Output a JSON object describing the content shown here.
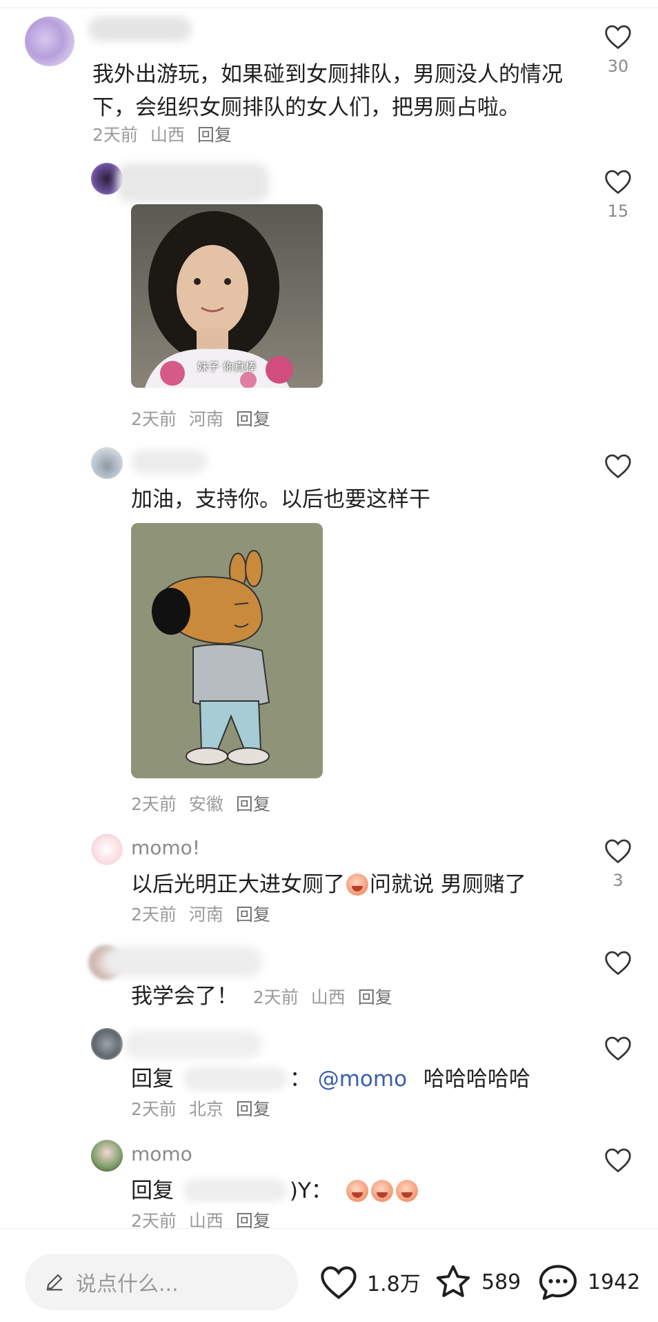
{
  "comments": [
    {
      "text": "我外出游玩，如果碰到女厕排队，男厕没人的情况下，会组织女厕排队的女人们，把男厕占啦。",
      "time": "2天前",
      "location": "山西",
      "reply": "回复",
      "likes": "30"
    },
    {
      "image_caption": "妹子 你真棒",
      "time": "2天前",
      "location": "河南",
      "reply": "回复",
      "likes": "15"
    },
    {
      "text": "加油，支持你。以后也要这样干",
      "time": "2天前",
      "location": "安徽",
      "reply": "回复",
      "likes": ""
    },
    {
      "name": "momo!",
      "text_before_emoji": "以后光明正大进女厕了",
      "text_after_emoji": "问就说 男厕赌了",
      "time": "2天前",
      "location": "河南",
      "reply": "回复",
      "likes": "3"
    },
    {
      "text": "我学会了！",
      "time": "2天前",
      "location": "山西",
      "reply": "回复",
      "likes": ""
    },
    {
      "reply_prefix": "回复",
      "reply_sep": "：",
      "mention": "@momo",
      "text": "哈哈哈哈哈",
      "time": "2天前",
      "location": "北京",
      "reply": "回复",
      "likes": ""
    },
    {
      "name": "momo",
      "reply_prefix": "回复",
      "reply_sep": ")Y：",
      "time": "2天前",
      "location": "山西",
      "reply": "回复",
      "likes": ""
    }
  ],
  "bottom_bar": {
    "input_placeholder": "说点什么...",
    "like_count": "1.8万",
    "star_count": "589",
    "comment_count": "1942"
  },
  "colors": {
    "mention": "#3a5ea8",
    "meta": "#9a9a9a",
    "text": "#1f1f1f"
  },
  "icons": [
    "heart-icon",
    "star-icon",
    "comment-bubble-icon",
    "pencil-icon",
    "crying-emoji"
  ]
}
